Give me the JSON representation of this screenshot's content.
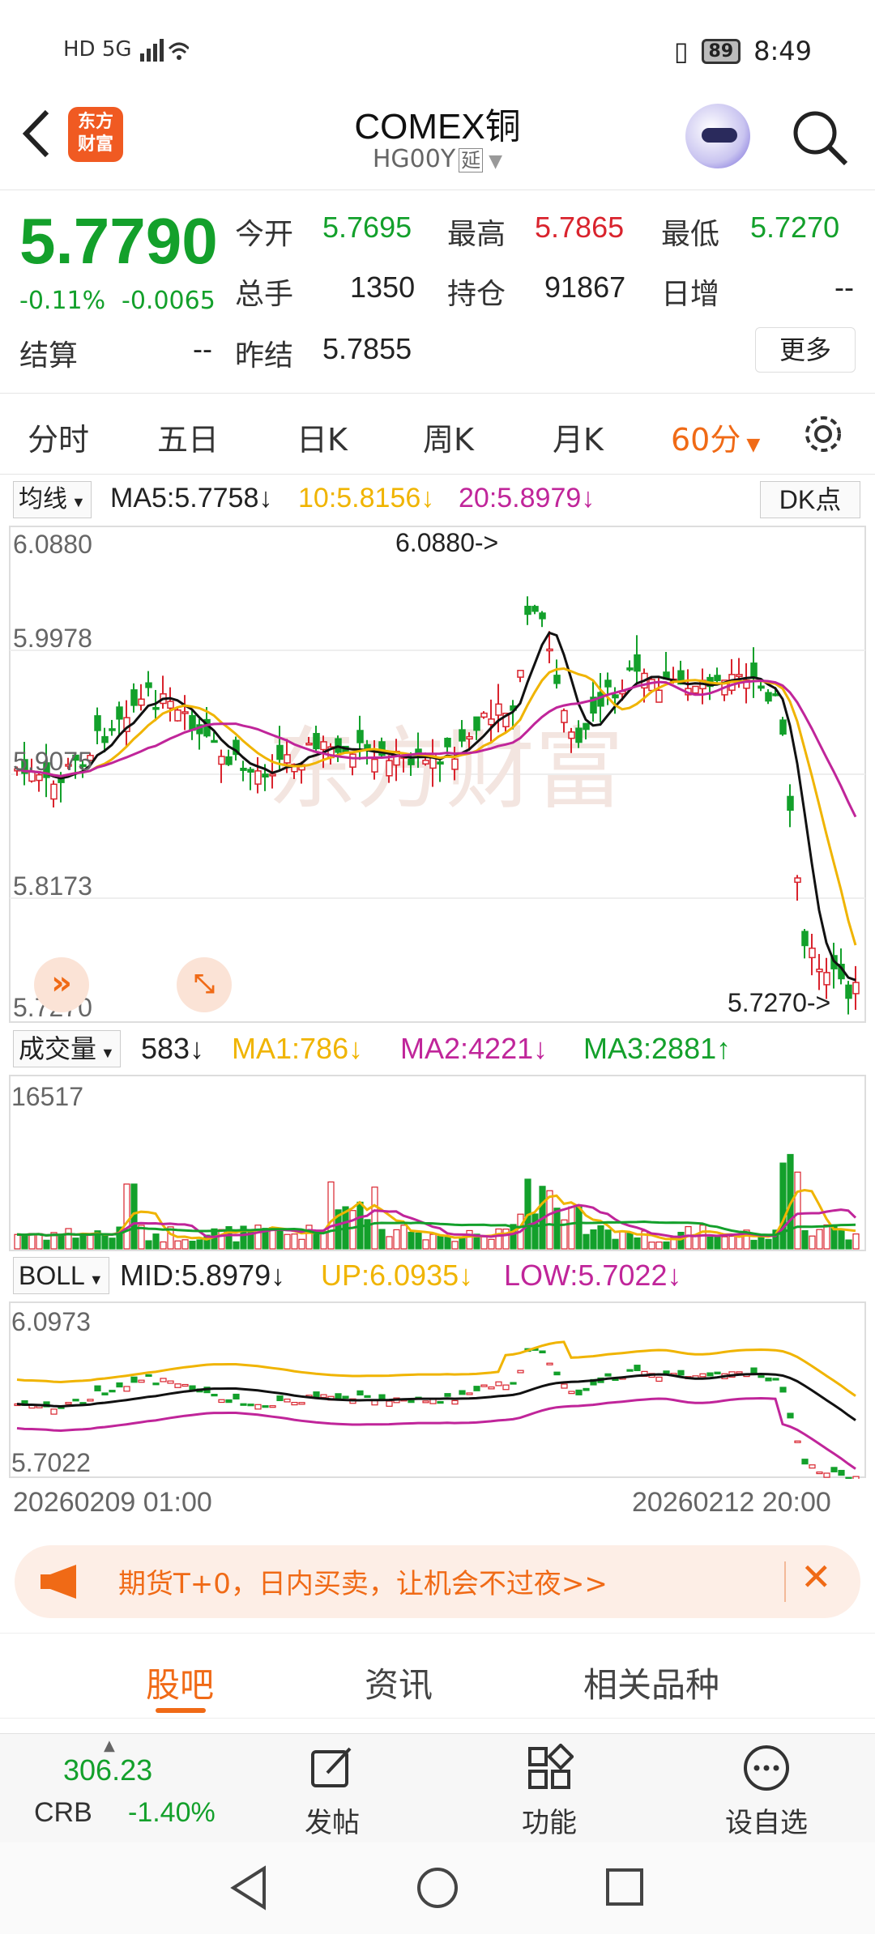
{
  "status": {
    "signal": "HD 5G",
    "battery": "89",
    "time": "8:49"
  },
  "header": {
    "logo_line1": "东方",
    "logo_line2": "财富",
    "title": "COMEX铜",
    "code": "HG00Y",
    "delay_tag": "延"
  },
  "quote": {
    "price": "5.7790",
    "change_pct": "-0.11%",
    "change": "-0.0065",
    "open_label": "今开",
    "open": "5.7695",
    "high_label": "最高",
    "high": "5.7865",
    "low_label": "最低",
    "low": "5.7270",
    "volume_label": "总手",
    "volume": "1350",
    "oi_label": "持仓",
    "oi": "91867",
    "day_inc_label": "日增",
    "day_inc": "--",
    "settle_label": "结算",
    "settle": "--",
    "prev_settle_label": "昨结",
    "prev_settle": "5.7855",
    "more_label": "更多"
  },
  "tabs": [
    "分时",
    "五日",
    "日K",
    "周K",
    "月K",
    "60分"
  ],
  "ma_bar": {
    "button": "均线",
    "ma5": "MA5:5.7758↓",
    "ma10": "10:5.8156↓",
    "ma20": "20:5.8979↓",
    "dk": "DK点"
  },
  "main_chart": {
    "y_labels": [
      "6.0880",
      "5.9978",
      "5.9075",
      "5.8173",
      "5.7270"
    ],
    "high_marker": "6.0880->",
    "low_marker": "5.7270->",
    "watermark": "东方财富"
  },
  "vol_bar": {
    "button": "成交量",
    "value": "583↓",
    "ma1": "MA1:786↓",
    "ma2": "MA2:4221↓",
    "ma3": "MA3:2881↑",
    "max_label": "16517"
  },
  "boll_bar": {
    "button": "BOLL",
    "mid": "MID:5.8979↓",
    "up": "UP:6.0935↓",
    "low": "LOW:5.7022↓",
    "top_label": "6.0973",
    "bottom_label": "5.7022"
  },
  "dates": {
    "start": "20260209 01:00",
    "end": "20260212 20:00"
  },
  "promo": {
    "text": "期货T+0，日内买卖，让机会不过夜>>"
  },
  "sub_tabs": [
    "股吧",
    "资讯",
    "相关品种"
  ],
  "toolbar": {
    "crb_value": "306.23",
    "crb_name": "CRB",
    "crb_pct": "-1.40%",
    "post": "发帖",
    "func": "功能",
    "watch": "设自选"
  },
  "colors": {
    "up": "#d9232d",
    "down": "#13a02b",
    "accent": "#f06a16",
    "ma10": "#f0b400",
    "ma20": "#c0259a"
  }
}
